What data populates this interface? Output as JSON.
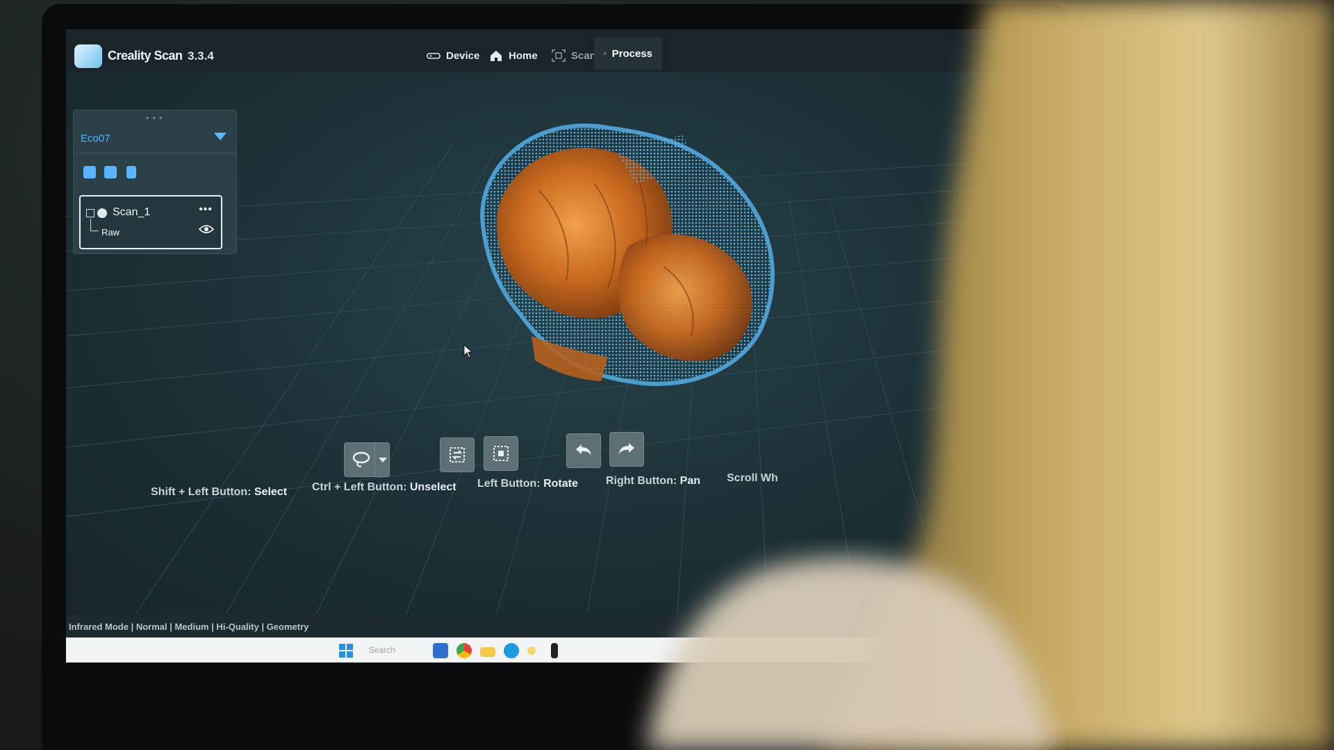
{
  "app": {
    "name": "Creality Scan",
    "version": "3.3.4"
  },
  "nav": {
    "device": "Device",
    "home": "Home",
    "scan": "Scan",
    "process": "Process",
    "active": "process"
  },
  "panel": {
    "device": "Eco07",
    "scan_name": "Scan_1",
    "more": "•••",
    "layer": "Raw"
  },
  "hints": {
    "select_key": "Shift + Left Button:",
    "select_action": "Select",
    "unselect_key": "Ctrl + Left Button:",
    "unselect_action": "Unselect",
    "rotate_key": "Left Button:",
    "rotate_action": "Rotate",
    "pan_key": "Right Button:",
    "pan_action": "Pan",
    "zoom_key": "Scroll Wh"
  },
  "status": {
    "text": "Infrared Mode | Normal | Medium | Hi-Quality | Geometry"
  },
  "taskbar": {
    "search": "Search"
  },
  "colors": {
    "accent": "#4fb2ff",
    "model_orange": "#c86a1f",
    "model_blue": "#4fa3d8"
  }
}
